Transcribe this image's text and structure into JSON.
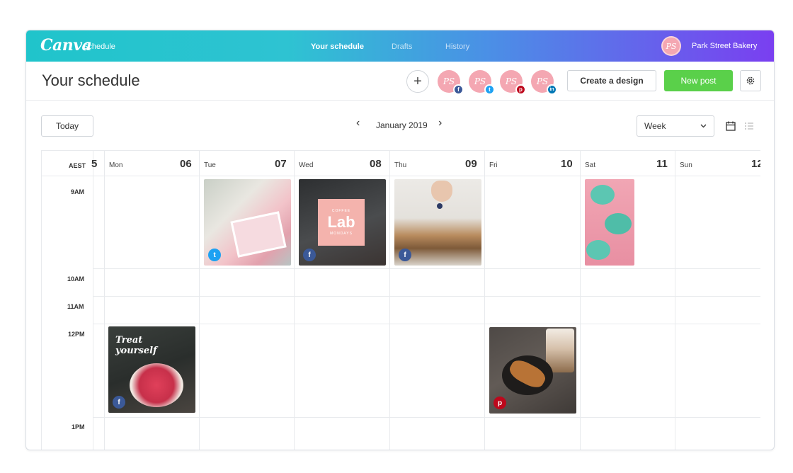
{
  "app": {
    "logo": "Canva",
    "sub": "Schedule"
  },
  "nav": {
    "schedule": "Your schedule",
    "drafts": "Drafts",
    "history": "History"
  },
  "account": {
    "initials": "PS",
    "name": "Park Street Bakery"
  },
  "header": {
    "title": "Your schedule",
    "add_symbol": "+",
    "create_label": "Create a design",
    "new_post_label": "New post",
    "social_accounts": [
      {
        "initials": "PS",
        "network": "facebook",
        "badge": "f",
        "color": "#3b5998"
      },
      {
        "initials": "PS",
        "network": "twitter",
        "badge": "t",
        "color": "#1da1f2"
      },
      {
        "initials": "PS",
        "network": "pinterest",
        "badge": "p",
        "color": "#bd081c"
      },
      {
        "initials": "PS",
        "network": "linkedin",
        "badge": "in",
        "color": "#0077b5"
      }
    ]
  },
  "toolbar": {
    "today": "Today",
    "month": "January 2019",
    "prev": "‹",
    "next": "›",
    "view": "Week"
  },
  "calendar": {
    "timezone": "AEST",
    "days": [
      {
        "name": "",
        "num": "5"
      },
      {
        "name": "Mon",
        "num": "06"
      },
      {
        "name": "Tue",
        "num": "07"
      },
      {
        "name": "Wed",
        "num": "08"
      },
      {
        "name": "Thu",
        "num": "09"
      },
      {
        "name": "Fri",
        "num": "10"
      },
      {
        "name": "Sat",
        "num": "11"
      },
      {
        "name": "Sun",
        "num": "12"
      }
    ],
    "times": [
      "9AM",
      "10AM",
      "11AM",
      "12PM",
      "1PM"
    ],
    "posts": [
      {
        "day": "Tue",
        "time": "9AM",
        "network": "twitter",
        "icon": "t",
        "color": "#1da1f2",
        "text": ""
      },
      {
        "day": "Wed",
        "time": "9AM",
        "network": "facebook",
        "icon": "f",
        "color": "#3b5998",
        "text": "Lab",
        "top_text": "COFFEE",
        "bottom_text": "MONDAYS"
      },
      {
        "day": "Thu",
        "time": "9AM",
        "network": "facebook",
        "icon": "f",
        "color": "#3b5998",
        "text": ""
      },
      {
        "day": "Sat",
        "time": "9AM",
        "network": "none",
        "icon": "",
        "color": "",
        "text": ""
      },
      {
        "day": "Mon",
        "time": "12PM",
        "network": "facebook",
        "icon": "f",
        "color": "#3b5998",
        "text": "Treat yourself"
      },
      {
        "day": "Fri",
        "time": "12PM",
        "network": "pinterest",
        "icon": "p",
        "color": "#bd081c",
        "text": ""
      }
    ]
  },
  "colors": {
    "accent_green": "#5ad04a",
    "gradient_start": "#20c4cb",
    "gradient_end": "#7a3ff0",
    "avatar_pink": "#f4a7b2"
  }
}
